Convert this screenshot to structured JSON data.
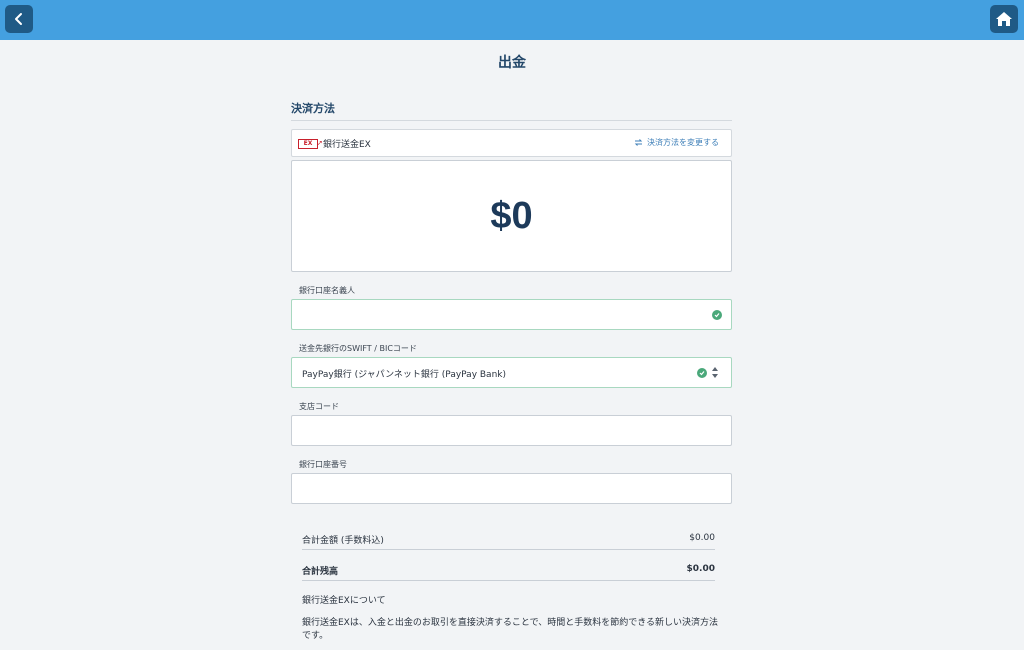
{
  "header": {
    "back_icon": "chevron-left-icon",
    "home_icon": "home-icon"
  },
  "page": {
    "title": "出金"
  },
  "payment": {
    "section_title": "決済方法",
    "method_logo_text": "EX",
    "method_name": "銀行送金EX",
    "change_label": "決済方法を変更する",
    "amount": "$0"
  },
  "fields": {
    "account_holder": {
      "label": "銀行口座名義人",
      "value": ""
    },
    "swift": {
      "label": "送金先銀行のSWIFT / BICコード",
      "value": "PayPay銀行 (ジャパンネット銀行 (PayPay Bank)"
    },
    "branch_code": {
      "label": "支店コード",
      "value": ""
    },
    "account_number": {
      "label": "銀行口座番号",
      "value": ""
    }
  },
  "summary": {
    "total_label": "合計金額 (手数料込)",
    "total_value": "$0.00",
    "balance_label": "合計残高",
    "balance_value": "$0.00"
  },
  "about": {
    "title": "銀行送金EXについて",
    "description": "銀行送金EXは、入金と出金のお取引を直接決済することで、時間と手数料を節約できる新しい決済方法です。"
  },
  "colors": {
    "header_bg": "#44a0e0",
    "button_bg": "#1f5a86",
    "title": "#24486a",
    "valid": "#4aa87a",
    "link": "#3e7fb8"
  }
}
